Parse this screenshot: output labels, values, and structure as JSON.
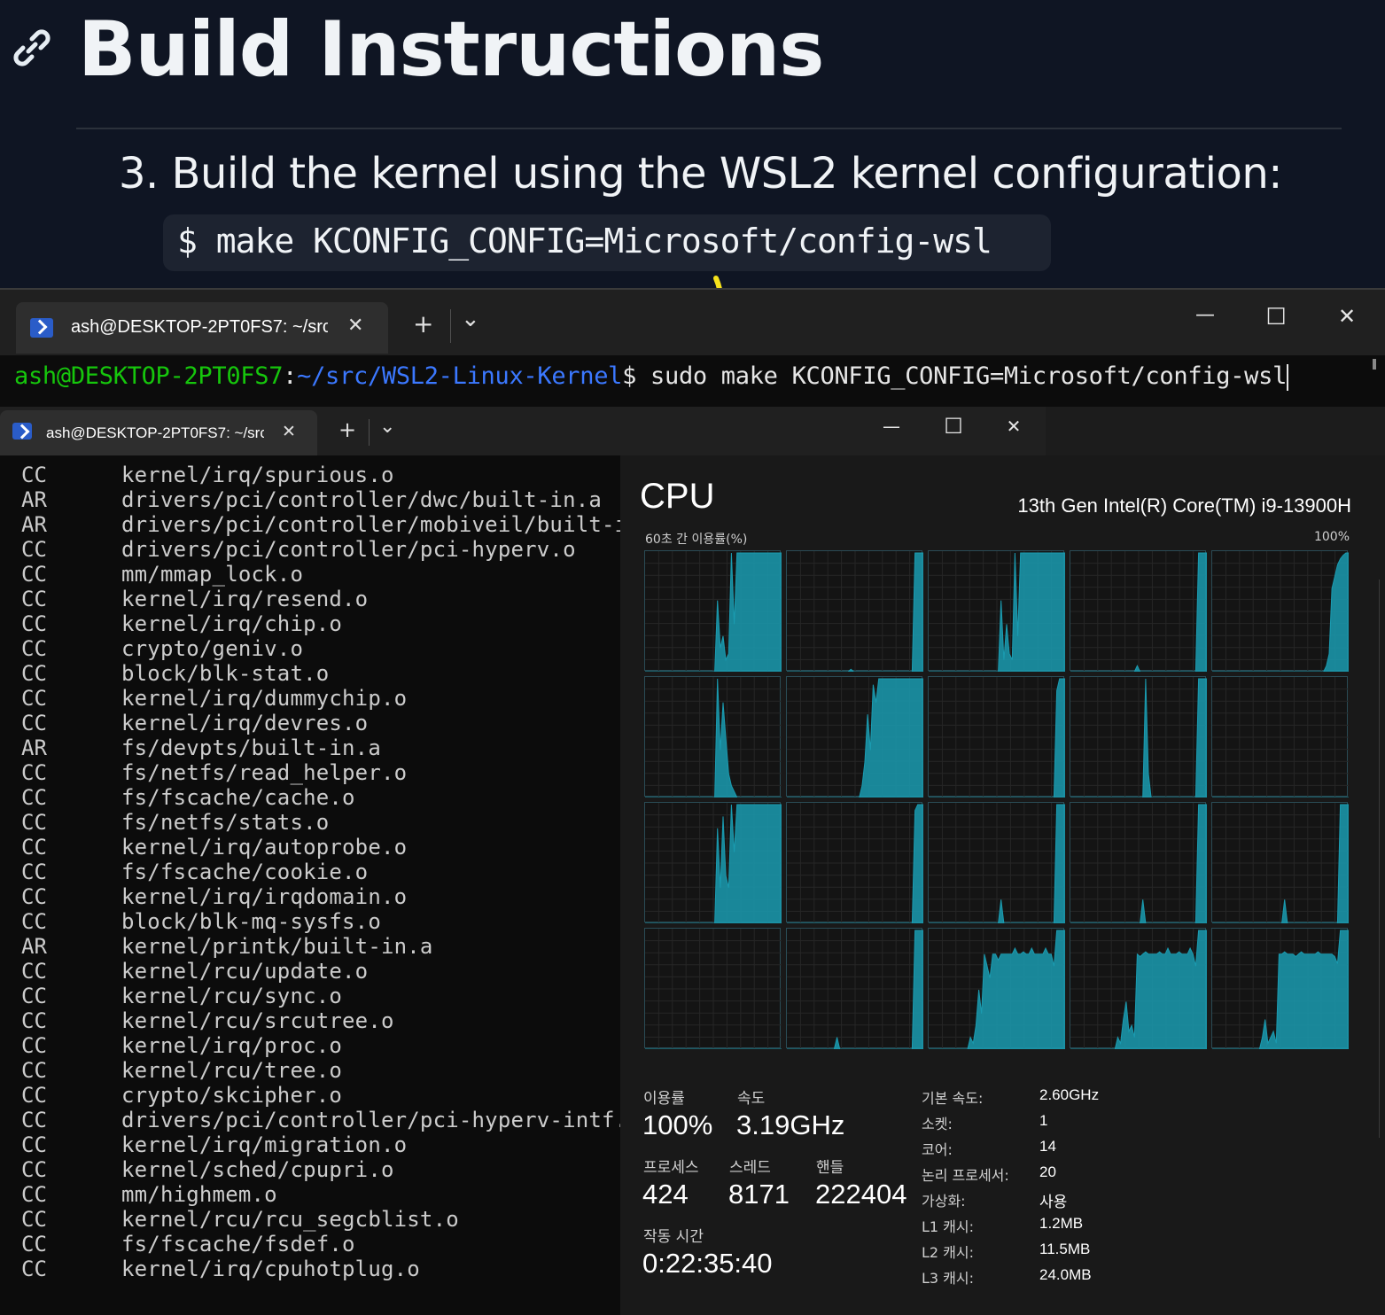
{
  "doc": {
    "title": "Build Instructions",
    "step": "3. Build the kernel using the WSL2 kernel configuration:",
    "code": "$ make KCONFIG_CONFIG=Microsoft/config-wsl"
  },
  "terminal_top": {
    "tab_title": "ash@DESKTOP-2PT0FS7: ~/src",
    "prompt_user": "ash@DESKTOP-2PT0FS7",
    "prompt_sep": ":",
    "prompt_path": "~/src/WSL2-Linux-Kernel",
    "prompt_sigil": "$",
    "command": " sudo make KCONFIG_CONFIG=Microsoft/config-wsl",
    "new_tab": "+",
    "dropdown": "⌄",
    "close_tab": "✕",
    "minimize": "—",
    "maximize": "☐",
    "close": "✕"
  },
  "terminal_bottom": {
    "tab_title": "ash@DESKTOP-2PT0FS7: ~/src",
    "new_tab": "+",
    "dropdown": "⌄",
    "close_tab": "✕",
    "minimize": "—",
    "maximize": "☐",
    "close": "✕",
    "lines": [
      {
        "kind": "CC",
        "path": "kernel/irq/spurious.o"
      },
      {
        "kind": "AR",
        "path": "drivers/pci/controller/dwc/built-in.a"
      },
      {
        "kind": "AR",
        "path": "drivers/pci/controller/mobiveil/built-in"
      },
      {
        "kind": "CC",
        "path": "drivers/pci/controller/pci-hyperv.o"
      },
      {
        "kind": "CC",
        "path": "mm/mmap_lock.o"
      },
      {
        "kind": "CC",
        "path": "kernel/irq/resend.o"
      },
      {
        "kind": "CC",
        "path": "kernel/irq/chip.o"
      },
      {
        "kind": "CC",
        "path": "crypto/geniv.o"
      },
      {
        "kind": "CC",
        "path": "block/blk-stat.o"
      },
      {
        "kind": "CC",
        "path": "kernel/irq/dummychip.o"
      },
      {
        "kind": "CC",
        "path": "kernel/irq/devres.o"
      },
      {
        "kind": "AR",
        "path": "fs/devpts/built-in.a"
      },
      {
        "kind": "CC",
        "path": "fs/netfs/read_helper.o"
      },
      {
        "kind": "CC",
        "path": "fs/fscache/cache.o"
      },
      {
        "kind": "CC",
        "path": "fs/netfs/stats.o"
      },
      {
        "kind": "CC",
        "path": "kernel/irq/autoprobe.o"
      },
      {
        "kind": "CC",
        "path": "fs/fscache/cookie.o"
      },
      {
        "kind": "CC",
        "path": "kernel/irq/irqdomain.o"
      },
      {
        "kind": "CC",
        "path": "block/blk-mq-sysfs.o"
      },
      {
        "kind": "AR",
        "path": "kernel/printk/built-in.a"
      },
      {
        "kind": "CC",
        "path": "kernel/rcu/update.o"
      },
      {
        "kind": "CC",
        "path": "kernel/rcu/sync.o"
      },
      {
        "kind": "CC",
        "path": "kernel/rcu/srcutree.o"
      },
      {
        "kind": "CC",
        "path": "kernel/irq/proc.o"
      },
      {
        "kind": "CC",
        "path": "kernel/rcu/tree.o"
      },
      {
        "kind": "CC",
        "path": "crypto/skcipher.o"
      },
      {
        "kind": "CC",
        "path": "drivers/pci/controller/pci-hyperv-intf.o"
      },
      {
        "kind": "CC",
        "path": "kernel/irq/migration.o"
      },
      {
        "kind": "CC",
        "path": "kernel/sched/cpupri.o"
      },
      {
        "kind": "CC",
        "path": "mm/highmem.o"
      },
      {
        "kind": "CC",
        "path": "kernel/rcu/rcu_segcblist.o"
      },
      {
        "kind": "CC",
        "path": "fs/fscache/fsdef.o"
      },
      {
        "kind": "CC",
        "path": "kernel/irq/cpuhotplug.o"
      }
    ]
  },
  "task_manager": {
    "title": "CPU",
    "model": "13th Gen Intel(R) Core(TM) i9-13900H",
    "usage_label": "60초 간 이용률(%)",
    "usage_max": "100%",
    "accent": "#1a9bb0",
    "stats": {
      "utilization_label": "이용률",
      "utilization": "100%",
      "speed_label": "속도",
      "speed": "3.19GHz",
      "processes_label": "프로세스",
      "processes": "424",
      "threads_label": "스레드",
      "threads": "8171",
      "handles_label": "핸들",
      "handles": "222404",
      "uptime_label": "작동 시간",
      "uptime": "0:22:35:40"
    },
    "specs": [
      {
        "key": "기본 속도:",
        "value": "2.60GHz"
      },
      {
        "key": "소켓:",
        "value": "1"
      },
      {
        "key": "코어:",
        "value": "14"
      },
      {
        "key": "논리 프로세서:",
        "value": "20"
      },
      {
        "key": "가상화:",
        "value": "사용"
      },
      {
        "key": "L1 캐시:",
        "value": "1.2MB"
      },
      {
        "key": "L2 캐시:",
        "value": "11.5MB"
      },
      {
        "key": "L3 캐시:",
        "value": "24.0MB"
      }
    ],
    "cores_usage": [
      [
        0,
        0,
        0,
        0,
        0,
        0,
        0,
        0,
        0,
        0,
        0,
        0,
        0,
        0,
        0,
        0,
        0,
        0,
        0,
        0,
        0,
        0,
        0,
        0,
        0,
        0,
        60,
        20,
        30,
        10,
        15,
        100,
        40,
        100,
        100,
        100,
        100,
        100,
        100,
        100,
        100,
        100,
        100,
        100,
        100,
        100,
        100,
        100,
        100,
        100
      ],
      [
        0,
        0,
        0,
        0,
        0,
        0,
        0,
        0,
        0,
        0,
        0,
        0,
        0,
        0,
        0,
        0,
        0,
        0,
        0,
        0,
        0,
        0,
        0,
        2,
        0,
        0,
        0,
        0,
        0,
        0,
        0,
        0,
        0,
        0,
        0,
        0,
        0,
        0,
        0,
        0,
        0,
        0,
        0,
        0,
        0,
        0,
        100,
        100,
        100,
        100
      ],
      [
        0,
        0,
        0,
        0,
        0,
        0,
        0,
        0,
        0,
        0,
        0,
        0,
        0,
        0,
        0,
        0,
        0,
        0,
        0,
        0,
        0,
        0,
        0,
        0,
        0,
        0,
        60,
        10,
        40,
        15,
        10,
        100,
        30,
        100,
        100,
        100,
        100,
        100,
        100,
        100,
        100,
        100,
        100,
        100,
        100,
        100,
        100,
        100,
        100,
        100
      ],
      [
        0,
        0,
        0,
        0,
        0,
        0,
        0,
        0,
        0,
        0,
        0,
        0,
        0,
        0,
        0,
        0,
        0,
        0,
        0,
        0,
        0,
        0,
        0,
        0,
        5,
        0,
        0,
        0,
        0,
        0,
        0,
        0,
        0,
        0,
        0,
        0,
        0,
        0,
        0,
        0,
        0,
        0,
        0,
        0,
        0,
        0,
        100,
        100,
        100,
        100
      ],
      [
        0,
        0,
        0,
        0,
        0,
        0,
        0,
        0,
        0,
        0,
        0,
        0,
        0,
        0,
        0,
        0,
        0,
        0,
        0,
        0,
        0,
        0,
        0,
        0,
        0,
        0,
        0,
        0,
        0,
        0,
        0,
        0,
        0,
        0,
        0,
        0,
        0,
        0,
        0,
        0,
        0,
        5,
        15,
        70,
        80,
        90,
        95,
        98,
        100,
        100
      ],
      [
        0,
        0,
        0,
        0,
        0,
        0,
        0,
        0,
        0,
        0,
        0,
        0,
        0,
        0,
        0,
        0,
        0,
        0,
        0,
        0,
        0,
        0,
        0,
        0,
        0,
        0,
        100,
        40,
        80,
        50,
        20,
        10,
        5,
        0,
        0,
        0,
        0,
        0,
        0,
        0,
        0,
        0,
        0,
        0,
        0,
        0,
        0,
        0,
        0,
        0
      ],
      [
        0,
        0,
        0,
        0,
        0,
        0,
        0,
        0,
        0,
        0,
        0,
        0,
        0,
        0,
        0,
        0,
        0,
        0,
        0,
        0,
        0,
        0,
        0,
        0,
        0,
        0,
        0,
        10,
        30,
        70,
        40,
        95,
        80,
        100,
        100,
        100,
        100,
        100,
        100,
        100,
        100,
        100,
        100,
        100,
        100,
        100,
        100,
        100,
        100,
        100
      ],
      [
        0,
        0,
        0,
        0,
        0,
        0,
        0,
        0,
        0,
        0,
        0,
        0,
        0,
        0,
        0,
        0,
        0,
        0,
        0,
        0,
        0,
        0,
        0,
        0,
        0,
        0,
        0,
        0,
        0,
        0,
        0,
        0,
        0,
        0,
        0,
        0,
        0,
        0,
        0,
        0,
        0,
        0,
        0,
        0,
        0,
        0,
        90,
        100,
        100,
        100
      ],
      [
        0,
        0,
        0,
        0,
        0,
        0,
        0,
        0,
        0,
        0,
        0,
        0,
        0,
        0,
        0,
        0,
        0,
        0,
        0,
        0,
        0,
        0,
        0,
        0,
        0,
        0,
        0,
        100,
        20,
        0,
        0,
        0,
        0,
        0,
        0,
        0,
        0,
        0,
        0,
        0,
        0,
        0,
        0,
        0,
        0,
        0,
        100,
        100,
        100,
        100
      ],
      [
        0,
        0,
        0,
        0,
        0,
        0,
        0,
        0,
        0,
        0,
        0,
        0,
        0,
        0,
        0,
        0,
        0,
        0,
        0,
        0,
        0,
        0,
        0,
        0,
        0,
        0,
        0,
        0,
        0,
        0,
        0,
        0,
        0,
        0,
        0,
        0,
        0,
        0,
        0,
        0,
        0,
        0,
        0,
        0,
        0,
        0,
        0,
        0,
        0,
        0
      ],
      [
        0,
        0,
        0,
        0,
        0,
        0,
        0,
        0,
        0,
        0,
        0,
        0,
        0,
        0,
        0,
        0,
        0,
        0,
        0,
        0,
        0,
        0,
        0,
        0,
        0,
        0,
        80,
        30,
        90,
        40,
        30,
        100,
        60,
        100,
        100,
        100,
        100,
        100,
        100,
        100,
        100,
        100,
        100,
        100,
        100,
        100,
        100,
        100,
        100,
        100
      ],
      [
        0,
        0,
        0,
        0,
        0,
        0,
        0,
        0,
        0,
        0,
        0,
        0,
        0,
        0,
        0,
        0,
        0,
        0,
        0,
        0,
        0,
        0,
        0,
        0,
        0,
        0,
        0,
        0,
        0,
        0,
        0,
        0,
        0,
        0,
        0,
        0,
        0,
        0,
        0,
        0,
        0,
        0,
        0,
        0,
        0,
        0,
        95,
        100,
        100,
        100
      ],
      [
        0,
        0,
        0,
        0,
        0,
        0,
        0,
        0,
        0,
        0,
        0,
        0,
        0,
        0,
        0,
        0,
        0,
        0,
        0,
        0,
        0,
        0,
        0,
        0,
        0,
        0,
        20,
        0,
        0,
        0,
        0,
        0,
        0,
        0,
        0,
        0,
        0,
        0,
        0,
        0,
        0,
        0,
        0,
        0,
        0,
        0,
        100,
        100,
        100,
        100
      ],
      [
        0,
        0,
        0,
        0,
        0,
        0,
        0,
        0,
        0,
        0,
        0,
        0,
        0,
        0,
        0,
        0,
        0,
        0,
        0,
        0,
        0,
        0,
        0,
        0,
        0,
        0,
        20,
        0,
        0,
        0,
        0,
        0,
        0,
        0,
        0,
        0,
        0,
        0,
        0,
        0,
        0,
        0,
        0,
        0,
        0,
        0,
        100,
        100,
        100,
        100
      ],
      [
        0,
        0,
        0,
        0,
        0,
        0,
        0,
        0,
        0,
        0,
        0,
        0,
        0,
        0,
        0,
        0,
        0,
        0,
        0,
        0,
        0,
        0,
        0,
        0,
        0,
        0,
        20,
        0,
        0,
        0,
        0,
        0,
        0,
        0,
        0,
        0,
        0,
        0,
        0,
        0,
        0,
        0,
        0,
        0,
        0,
        0,
        100,
        100,
        100,
        100
      ],
      [
        0,
        0,
        0,
        0,
        0,
        0,
        0,
        0,
        0,
        0,
        0,
        0,
        0,
        0,
        0,
        0,
        0,
        0,
        0,
        0,
        0,
        0,
        0,
        0,
        0,
        0,
        0,
        0,
        0,
        0,
        0,
        0,
        0,
        0,
        0,
        0,
        0,
        0,
        0,
        0,
        0,
        0,
        0,
        0,
        0,
        0,
        0,
        0,
        0,
        0
      ],
      [
        0,
        0,
        0,
        0,
        0,
        0,
        0,
        0,
        0,
        0,
        0,
        0,
        0,
        0,
        0,
        0,
        0,
        0,
        10,
        0,
        0,
        0,
        0,
        0,
        0,
        0,
        0,
        0,
        0,
        0,
        0,
        0,
        0,
        0,
        0,
        0,
        0,
        0,
        0,
        0,
        0,
        0,
        0,
        0,
        0,
        0,
        100,
        100,
        100,
        100
      ],
      [
        0,
        0,
        0,
        0,
        0,
        0,
        0,
        0,
        0,
        0,
        0,
        0,
        0,
        0,
        0,
        10,
        5,
        20,
        50,
        30,
        80,
        70,
        60,
        80,
        80,
        75,
        80,
        80,
        80,
        80,
        80,
        85,
        80,
        80,
        82,
        80,
        80,
        85,
        80,
        80,
        80,
        80,
        85,
        80,
        80,
        70,
        100,
        100,
        100,
        100
      ],
      [
        0,
        0,
        0,
        0,
        0,
        0,
        0,
        0,
        0,
        0,
        0,
        0,
        0,
        0,
        0,
        0,
        0,
        10,
        5,
        25,
        40,
        15,
        20,
        10,
        80,
        78,
        80,
        82,
        80,
        80,
        80,
        80,
        82,
        80,
        80,
        85,
        80,
        80,
        80,
        82,
        80,
        80,
        80,
        85,
        80,
        70,
        100,
        100,
        100,
        100
      ],
      [
        0,
        0,
        0,
        0,
        0,
        0,
        0,
        0,
        0,
        0,
        0,
        0,
        0,
        0,
        0,
        0,
        0,
        0,
        10,
        25,
        5,
        10,
        15,
        5,
        80,
        80,
        82,
        80,
        80,
        80,
        78,
        80,
        82,
        80,
        80,
        80,
        80,
        80,
        82,
        80,
        80,
        80,
        80,
        80,
        78,
        72,
        100,
        100,
        100,
        100
      ]
    ]
  }
}
